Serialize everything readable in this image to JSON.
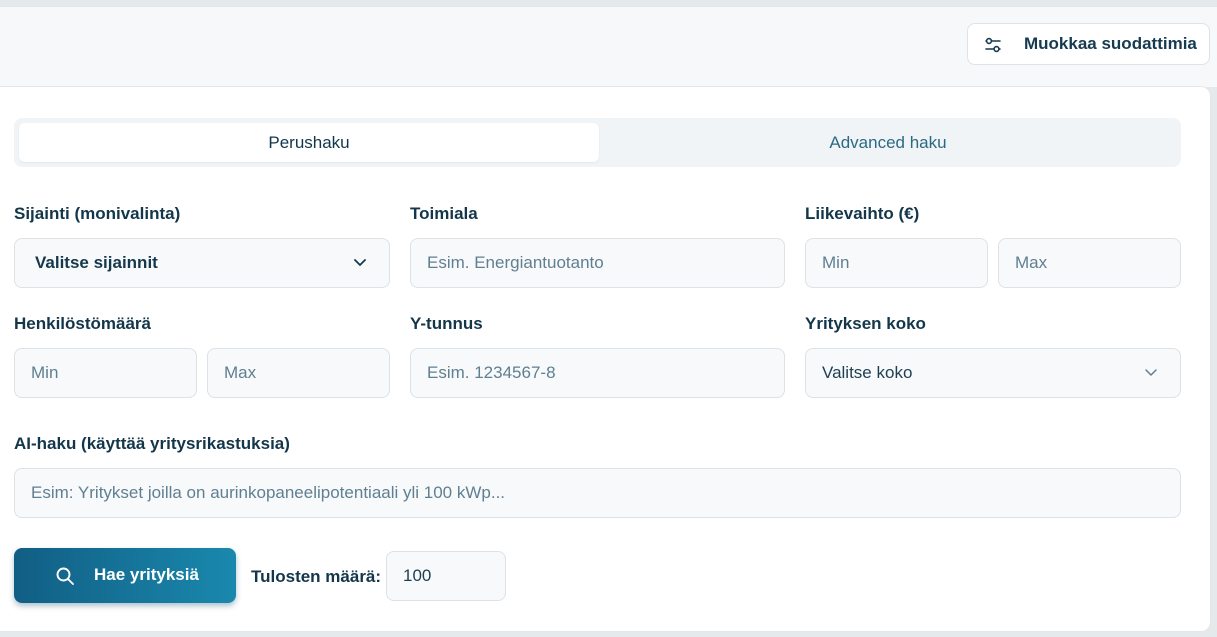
{
  "header": {
    "edit_filters_label": "Muokkaa suodattimia"
  },
  "tabs": [
    {
      "label": "Perushaku",
      "active": true
    },
    {
      "label": "Advanced haku",
      "active": false
    }
  ],
  "form": {
    "location": {
      "label": "Sijainti (monivalinta)",
      "value": "Valitse sijainnit"
    },
    "industry": {
      "label": "Toimiala",
      "placeholder": "Esim. Energiantuotanto"
    },
    "revenue": {
      "label": "Liikevaihto (€)",
      "min_placeholder": "Min",
      "max_placeholder": "Max"
    },
    "employees": {
      "label": "Henkilöstömäärä",
      "min_placeholder": "Min",
      "max_placeholder": "Max"
    },
    "business_id": {
      "label": "Y-tunnus",
      "placeholder": "Esim. 1234567-8"
    },
    "company_size": {
      "label": "Yrityksen koko",
      "value": "Valitse koko"
    },
    "ai_search": {
      "label": "AI-haku (käyttää yritysrikastuksia)",
      "placeholder": "Esim: Yritykset joilla on aurinkopaneelipotentiaali yli 100 kWp..."
    }
  },
  "actions": {
    "search_label": "Hae yrityksiä",
    "result_count_label": "Tulosten määrä:",
    "result_count_value": "100"
  },
  "colors": {
    "accent_start": "#115e84",
    "accent_end": "#1a88ad",
    "text_primary": "#14364a"
  }
}
